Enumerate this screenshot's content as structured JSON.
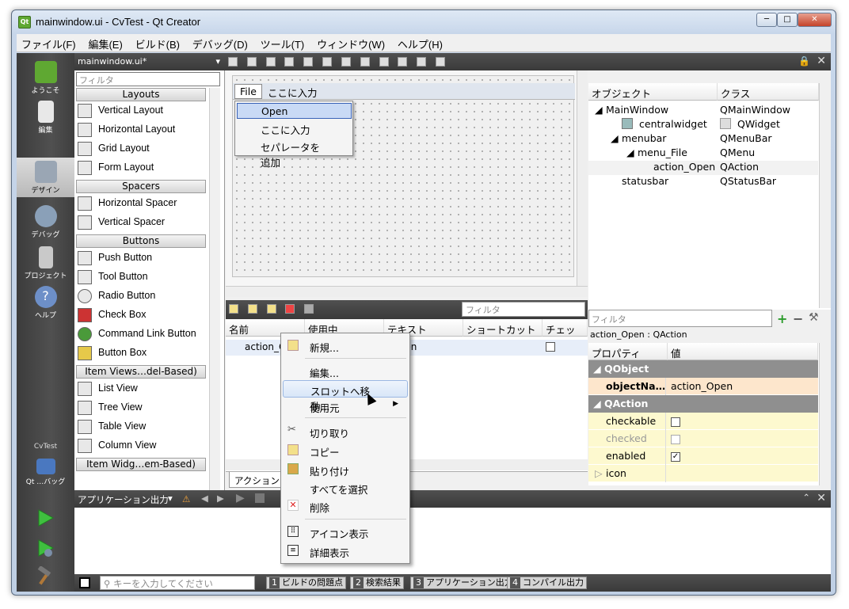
{
  "window": {
    "title": "mainwindow.ui - CvTest - Qt Creator",
    "app_icon": "Qt",
    "min": "─",
    "max": "□",
    "close": "✕"
  },
  "menubar": [
    "ファイル(F)",
    "編集(E)",
    "ビルド(B)",
    "デバッグ(D)",
    "ツール(T)",
    "ウィンドウ(W)",
    "ヘルプ(H)"
  ],
  "modes": {
    "welcome": "ようこそ",
    "edit": "編集",
    "design": "デザイン",
    "debug": "デバッグ",
    "projects": "プロジェクト",
    "help": "ヘルプ",
    "kit_label": "CvTest",
    "kit_target": "Qt …バッグ"
  },
  "editor": {
    "file_tab": "mainwindow.ui*"
  },
  "widgetbox": {
    "filter_placeholder": "フィルタ",
    "cat_layouts": "Layouts",
    "vertical_layout": "Vertical Layout",
    "horizontal_layout": "Horizontal Layout",
    "grid_layout": "Grid Layout",
    "form_layout": "Form Layout",
    "cat_spacers": "Spacers",
    "horizontal_spacer": "Horizontal Spacer",
    "vertical_spacer": "Vertical Spacer",
    "cat_buttons": "Buttons",
    "push_button": "Push Button",
    "tool_button": "Tool Button",
    "radio_button": "Radio Button",
    "check_box": "Check Box",
    "command_link_button": "Command Link Button",
    "button_box": "Button Box",
    "cat_item_views": "Item Views…del-Based)",
    "list_view": "List View",
    "tree_view": "Tree View",
    "table_view": "Table View",
    "column_view": "Column View",
    "cat_item_widgets": "Item Widg…em-Based)"
  },
  "form": {
    "menu_file": "File",
    "type_here": "ここに入力",
    "dropdown": {
      "open": "Open",
      "type_here": "ここに入力",
      "add_separator": "セパレータを追加"
    }
  },
  "action_editor": {
    "filter_placeholder": "フィルタ",
    "columns": {
      "name": "名前",
      "used": "使用中",
      "text": "テキスト",
      "shortcut": "ショートカット",
      "checkable": "チェック可"
    },
    "row": {
      "name": "action_O",
      "text": "&Open"
    },
    "tab_label": "アクション エディタ"
  },
  "object_inspector": {
    "col_object": "オブジェクト",
    "col_class": "クラス",
    "rows": [
      {
        "obj": "MainWindow",
        "cls": "QMainWindow"
      },
      {
        "obj": "centralwidget",
        "cls": "QWidget"
      },
      {
        "obj": "menubar",
        "cls": "QMenuBar"
      },
      {
        "obj": "menu_File",
        "cls": "QMenu"
      },
      {
        "obj": "action_Open",
        "cls": "QAction"
      },
      {
        "obj": "statusbar",
        "cls": "QStatusBar"
      }
    ]
  },
  "property_editor": {
    "filter_placeholder": "フィルタ",
    "class_label": "action_Open : QAction",
    "col_property": "プロパティ",
    "col_value": "値",
    "group_qobject": "QObject",
    "objectname_key": "objectNa…",
    "objectname_val": "action_Open",
    "group_qaction": "QAction",
    "checkable": "checkable",
    "checked": "checked",
    "enabled": "enabled",
    "icon": "icon",
    "checkable_val": false,
    "checked_val": false,
    "enabled_val": true
  },
  "output": {
    "title": "アプリケーション出力"
  },
  "locator": {
    "placeholder": "キーを入力してください",
    "tabs": [
      {
        "n": "1",
        "label": "ビルドの問題点"
      },
      {
        "n": "2",
        "label": "検索結果"
      },
      {
        "n": "3",
        "label": "アプリケーション出力"
      },
      {
        "n": "4",
        "label": "コンパイル出力"
      }
    ]
  },
  "context_menu": {
    "new": "新規...",
    "edit": "編集...",
    "go_to_slot": "スロットへ移動...",
    "used_in": "使用元",
    "cut": "切り取り",
    "copy": "コピー",
    "paste": "貼り付け",
    "select_all": "すべてを選択",
    "delete": "削除",
    "icon_view": "アイコン表示",
    "detail_view": "詳細表示"
  }
}
